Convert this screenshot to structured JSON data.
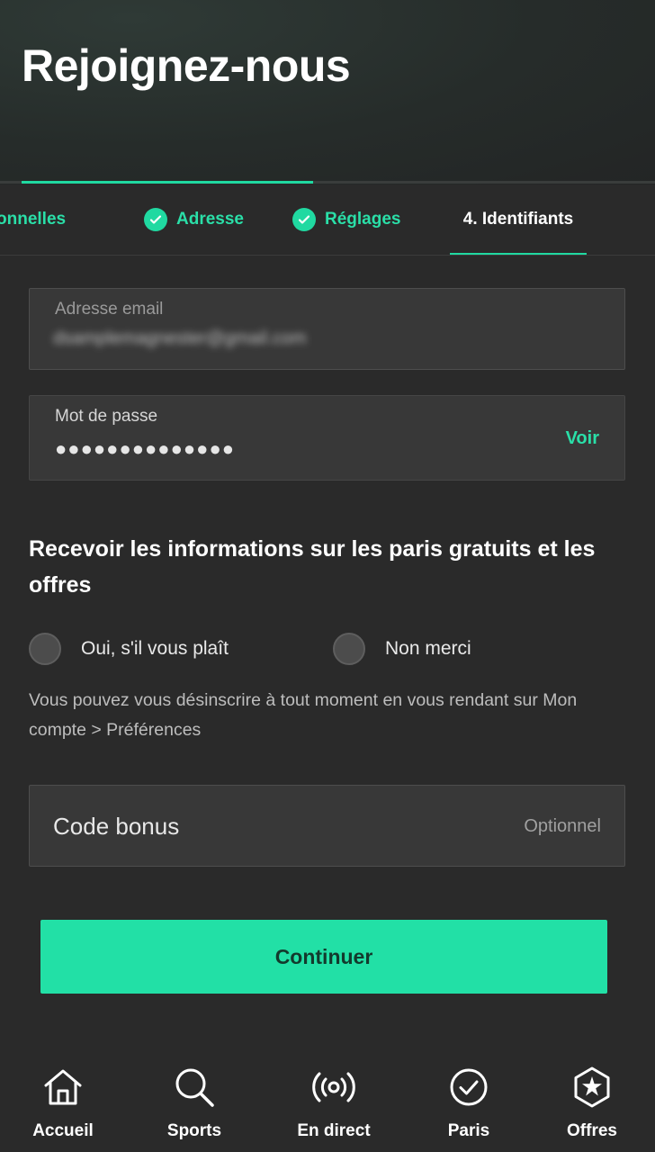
{
  "header": {
    "title": "Rejoignez-nous",
    "progress": 0.5
  },
  "steps": [
    {
      "label": "onnelles",
      "done": false
    },
    {
      "label": "Adresse",
      "done": true
    },
    {
      "label": "Réglages",
      "done": true
    },
    {
      "label": "4. Identifiants",
      "active": true
    }
  ],
  "form": {
    "email": {
      "label": "Adresse email",
      "value": "dsamplemagnester@gmail.com"
    },
    "password": {
      "label": "Mot de passe",
      "value": "●●●●●●●●●●●●●●",
      "toggle_label": "Voir"
    },
    "info_title": "Recevoir les informations sur les paris gratuits et les offres",
    "options": [
      {
        "label": "Oui, s'il vous plaît"
      },
      {
        "label": "Non merci"
      }
    ],
    "notice": "Vous pouvez vous désinscrire à tout moment en vous rendant sur Mon compte > Préférences",
    "bonus": {
      "label": "Code bonus",
      "hint": "Optionnel"
    },
    "submit_label": "Continuer"
  },
  "nav": [
    {
      "label": "Accueil",
      "icon": "home-icon"
    },
    {
      "label": "Sports",
      "icon": "search-icon"
    },
    {
      "label": "En direct",
      "icon": "broadcast-icon"
    },
    {
      "label": "Paris",
      "icon": "check-circle-icon"
    },
    {
      "label": "Offres",
      "icon": "star-badge-icon"
    }
  ],
  "colors": {
    "accent": "#20d9a1",
    "background": "#2a2a2a",
    "field": "#383838"
  }
}
